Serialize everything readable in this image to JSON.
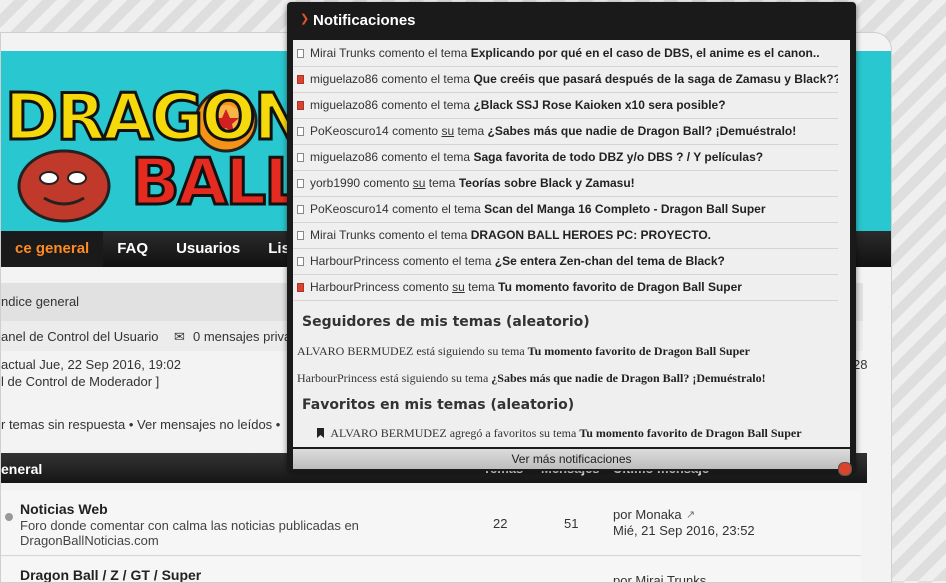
{
  "notifications": {
    "title": "Notificaciones",
    "items": [
      {
        "user": "Mirai Trunks",
        "action": "comento el tema",
        "topic": "Explicando por qué en el caso de DBS, el anime es el canon..",
        "hot": false,
        "own": false
      },
      {
        "user": "miguelazo86",
        "action": "comento el tema",
        "topic": "Que creéis que pasará después de la saga de Zamasu y Black??",
        "hot": true,
        "own": false
      },
      {
        "user": "miguelazo86",
        "action": "comento el tema",
        "topic": "¿Black SSJ Rose Kaioken x10 sera posible?",
        "hot": true,
        "own": false
      },
      {
        "user": "PoKeoscuro14",
        "action": "comento",
        "topic": "¿Sabes más que nadie de Dragon Ball? ¡Demuéstralo!",
        "hot": false,
        "own": true
      },
      {
        "user": "miguelazo86",
        "action": "comento el tema",
        "topic": "Saga favorita de todo DBZ y/o DBS ? / Y películas?",
        "hot": false,
        "own": false
      },
      {
        "user": "yorb1990",
        "action": "comento",
        "topic": "Teorías sobre Black y Zamasu!",
        "hot": false,
        "own": true
      },
      {
        "user": "PoKeoscuro14",
        "action": "comento el tema",
        "topic": "Scan del Manga 16 Completo - Dragon Ball Super",
        "hot": false,
        "own": false
      },
      {
        "user": "Mirai Trunks",
        "action": "comento el tema",
        "topic": "DRAGON BALL HEROES PC: PROYECTO.",
        "hot": false,
        "own": false
      },
      {
        "user": "HarbourPrincess",
        "action": "comento el tema",
        "topic": "¿Se entera Zen-chan del tema de Black?",
        "hot": false,
        "own": false
      },
      {
        "user": "HarbourPrincess",
        "action": "comento",
        "topic": "Tu momento favorito de Dragon Ball Super",
        "hot": true,
        "own": true
      }
    ],
    "own_word": "su",
    "own_suffix": "tema",
    "followers_title": "Seguidores de mis temas (aleatorio)",
    "followers": [
      {
        "user": "ALVARO BERMUDEZ",
        "text": "está siguiendo su tema",
        "topic": "Tu momento favorito de Dragon Ball Super"
      },
      {
        "user": "HarbourPrincess",
        "text": "está siguiendo su tema",
        "topic": "¿Sabes más que nadie de Dragon Ball? ¡Demuéstralo!"
      }
    ],
    "favorites_title": "Favoritos en mis temas (aleatorio)",
    "favorites": [
      {
        "user": "ALVARO BERMUDEZ",
        "text": "agregó a favoritos su tema",
        "topic": "Tu momento favorito de Dragon Ball Super"
      }
    ],
    "more": "Ver más notificaciones"
  },
  "site": {
    "logo_top": "DRAGON",
    "logo_bottom": "BALL",
    "nav": [
      "ce general",
      "FAQ",
      "Usuarios",
      "Lista To"
    ],
    "breadcrumb": "ndice general",
    "ucp": "anel de Control del Usuario",
    "messages": "0 mensajes priva",
    "date_line": "actual Jue, 22 Sep 2016, 19:02",
    "mcp_line": "l de Control de Moderador ]",
    "links_line": "r temas sin respuesta • Ver mensajes no leídos •",
    "right_num": "28",
    "forum_head": "eneral",
    "col_topics": "Temas",
    "col_posts": "Mensajes",
    "col_last": "Último mensaje",
    "forums": [
      {
        "title": "Noticias Web",
        "desc": "Foro donde comentar con calma las noticias publicadas en DragonBallNoticias.com",
        "topics": "22",
        "posts": "51",
        "last_by": "por Monaka",
        "last_date": "Mié, 21 Sep 2016, 23:52"
      },
      {
        "title": "Dragon Ball / Z / GT / Super",
        "desc": "",
        "topics": "",
        "posts": "",
        "last_by": "por Mirai Trunks",
        "last_date": ""
      }
    ]
  }
}
